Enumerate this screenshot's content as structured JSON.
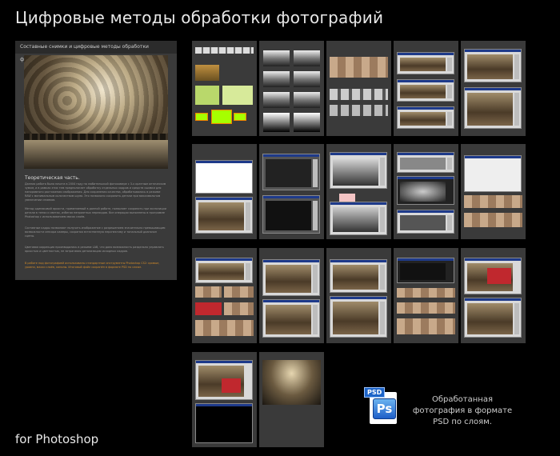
{
  "page": {
    "title": "Цифровые методы обработки фотографий",
    "footer": "for Photoshop"
  },
  "main_panel": {
    "header": "Составные снимки и цифровые методы обработки фотографии.",
    "caption": "Фото: ...",
    "theory_title": "Теоретическая часть.",
    "paragraphs": [
      "Данная работа была начата в 2004 году на любительской фотокамере с 3-х кратным оптическим зумом, и в рамках этих тем предполагает обработку отдельных кадров и средств сшивки для панорамного растяжения изображения. Для сохранения качества, обрабатывалась в режиме RAW с минимальным количеством шума. Это позволило сохранить детали при максимальном увеличении снимков.",
      "Метод одинаковой яркости, применяемый в данной работе, позволяет сохранить при экспозиции детали в тенях и светах, избегая неприятных переходов. Все операции выполнены в программе Photoshop с использованием масок слоёв.",
      "Составные кадры позволяют получить изображение с разрешением значительно превышающим возможности сенсора камеры, сохраняя естественную перспективу и тональный диапазон сцены.",
      "Цветовая коррекция производилась в режиме LAB, что дало возможность раздельно управлять яркостью и цветностью, не затрагивая детализацию исходных кадров.",
      "В работе над фотографией использованы стандартные инструменты Photoshop CS2: кривые, уровни, маски слоёв, каналы. Итоговый файл сохранён в формате PSD по слоям."
    ],
    "footnote": "..."
  },
  "psd_badge": {
    "label": "PSD",
    "ps": "Ps"
  },
  "note": "Обработанная фотография в формате PSD по слоям.",
  "colors": {
    "background": "#000000",
    "panel": "#3a3a3a",
    "accent_orange": "#f08000",
    "ps_blue": "#1f5fc8"
  }
}
